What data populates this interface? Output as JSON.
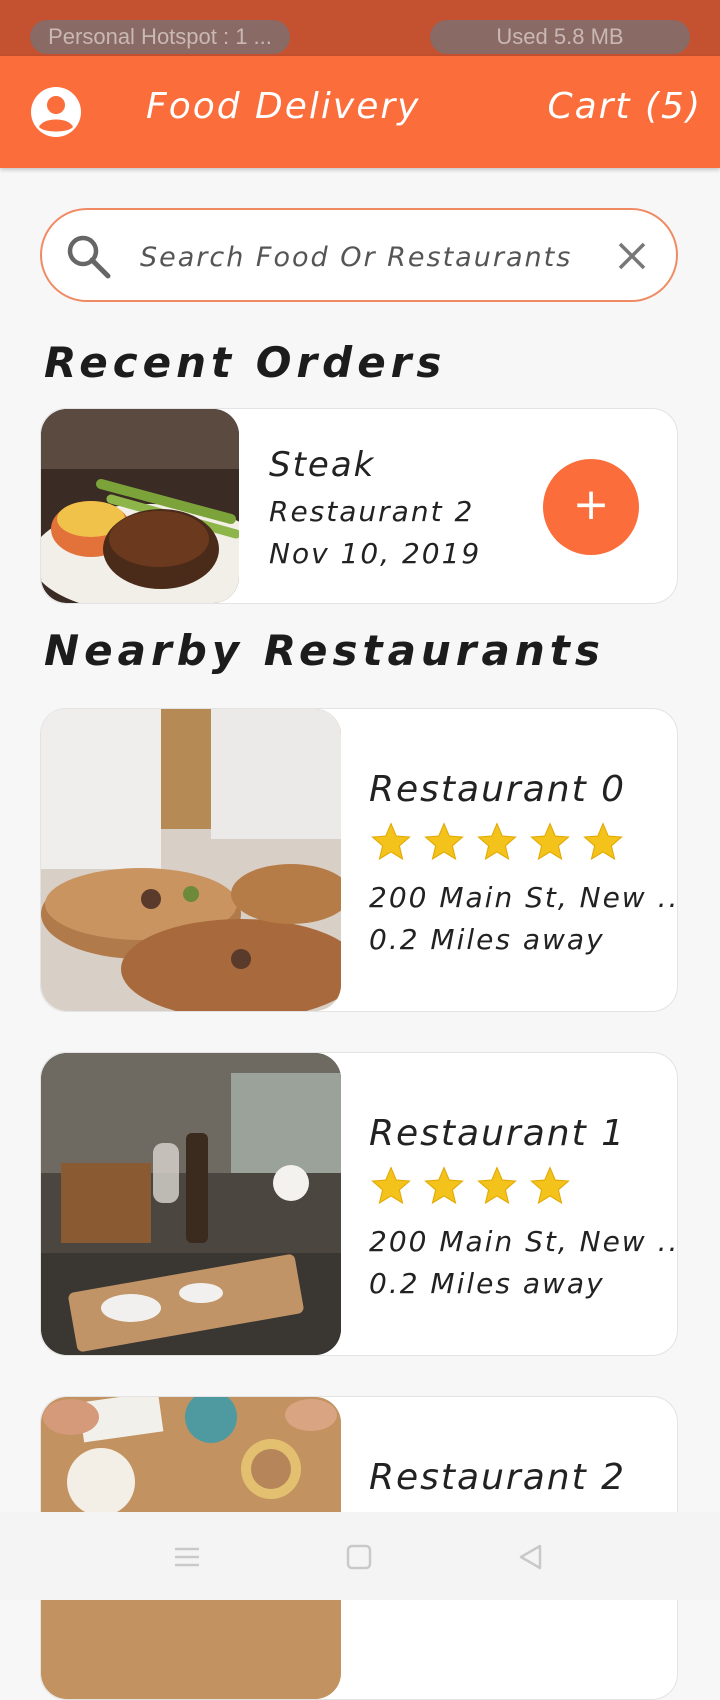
{
  "status_bar": {
    "hotspot": "Personal Hotspot : 1 ...",
    "data_used": "Used  5.8 MB"
  },
  "app_bar": {
    "title": "Food Delivery",
    "cart": "Cart (5)"
  },
  "search": {
    "placeholder": "Search Food Or Restaurants"
  },
  "recent_orders": {
    "heading": "Recent Orders",
    "items": [
      {
        "dish": "Steak",
        "restaurant": "Restaurant 2",
        "date": "Nov 10, 2019",
        "add_label": "+"
      }
    ]
  },
  "nearby": {
    "heading": "Nearby Restaurants",
    "restaurants": [
      {
        "name": "Restaurant 0",
        "rating": 5,
        "address": "200 Main St, New ...",
        "distance": "0.2 Miles away"
      },
      {
        "name": "Restaurant 1",
        "rating": 4,
        "address": "200 Main St, New ...",
        "distance": "0.2 Miles away"
      },
      {
        "name": "Restaurant 2"
      }
    ]
  },
  "colors": {
    "accent": "#fb6d3a",
    "status_bar": "#c4512f",
    "star": "#f3c31c"
  }
}
